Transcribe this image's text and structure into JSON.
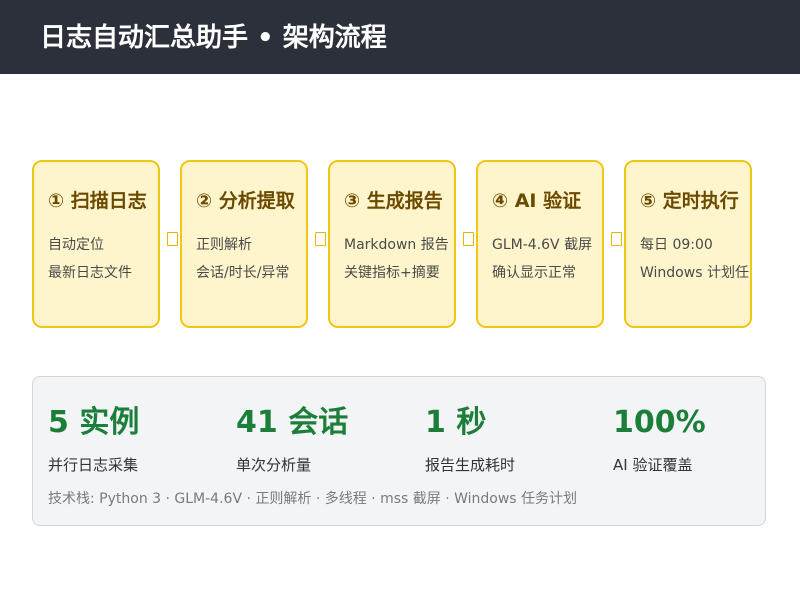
{
  "header": {
    "title": "日志自动汇总助手 • 架构流程"
  },
  "steps": [
    {
      "title": "① 扫描日志",
      "line1": "自动定位",
      "line2": "最新日志文件"
    },
    {
      "title": "② 分析提取",
      "line1": "正则解析",
      "line2": "会话/时长/异常"
    },
    {
      "title": "③ 生成报告",
      "line1": "Markdown 报告",
      "line2": "关键指标+摘要"
    },
    {
      "title": "④ AI 验证",
      "line1": "GLM-4.6V 截屏",
      "line2": "确认显示正常"
    },
    {
      "title": "⑤ 定时执行",
      "line1": "每日 09:00",
      "line2": "Windows 计划任务"
    }
  ],
  "stats": [
    {
      "value": "5 实例",
      "label": "并行日志采集"
    },
    {
      "value": "41 会话",
      "label": "单次分析量"
    },
    {
      "value": "1 秒",
      "label": "报告生成耗时"
    },
    {
      "value": "100%",
      "label": "AI 验证覆盖"
    }
  ],
  "tech_stack": "技术栈: Python 3 · GLM-4.6V · 正则解析 · 多线程 · mss 截屏 · Windows 任务计划",
  "colors": {
    "header_bg": "#2b303a",
    "card_bg": "#fff5cc",
    "card_border": "#f2c614",
    "step_title": "#6b4a00",
    "stat_value": "#1b7f3a",
    "panel_bg": "#f3f4f6"
  },
  "icons": {
    "connector": "arrow-placeholder-icon"
  }
}
